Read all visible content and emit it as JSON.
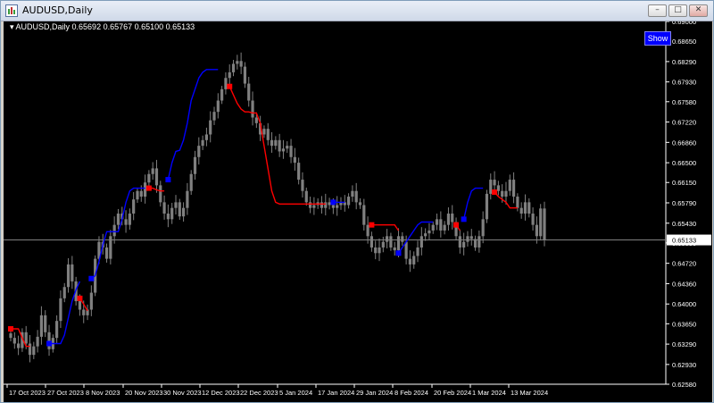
{
  "window": {
    "title": "AUDUSD,Daily",
    "buttons": [
      "minimize",
      "restore",
      "close"
    ],
    "icons": {
      "minimize": "–",
      "restore": "□",
      "close": "✕"
    }
  },
  "chart": {
    "info_line": "AUDUSD,Daily  0.65692 0.65767 0.65100 0.65133",
    "current_price": "0.65133",
    "show_button": "Show",
    "colors": {
      "background": "#000000",
      "candles": "#808080",
      "uptrend": "#0000ff",
      "downtrend": "#ff0000",
      "text": "#ffffff"
    }
  },
  "chart_data": {
    "type": "line",
    "symbol": "AUDUSD",
    "timeframe": "Daily",
    "x_labels": [
      "17 Oct 2023",
      "27 Oct 2023",
      "8 Nov 2023",
      "20 Nov 2023",
      "30 Nov 2023",
      "12 Dec 2023",
      "22 Dec 2023",
      "5 Jan 2024",
      "17 Jan 2024",
      "29 Jan 2024",
      "8 Feb 2024",
      "20 Feb 2024",
      "1 Mar 2024",
      "13 Mar 2024"
    ],
    "y_ticks": [
      "0.69000",
      "0.68650",
      "0.68290",
      "0.67930",
      "0.67580",
      "0.67220",
      "0.66860",
      "0.66500",
      "0.66150",
      "0.65790",
      "0.65430",
      "0.65080",
      "0.64720",
      "0.64360",
      "0.64000",
      "0.63650",
      "0.63290",
      "0.62930",
      "0.62580"
    ],
    "ylim": [
      0.6258,
      0.69
    ],
    "current_price": 0.65133,
    "close_prices": [
      0.634,
      0.633,
      0.6322,
      0.635,
      0.633,
      0.631,
      0.6325,
      0.6342,
      0.638,
      0.635,
      0.632,
      0.634,
      0.637,
      0.641,
      0.643,
      0.647,
      0.644,
      0.6405,
      0.639,
      0.638,
      0.639,
      0.642,
      0.648,
      0.651,
      0.65,
      0.648,
      0.652,
      0.654,
      0.656,
      0.655,
      0.654,
      0.656,
      0.6585,
      0.66,
      0.659,
      0.6615,
      0.663,
      0.664,
      0.661,
      0.658,
      0.656,
      0.655,
      0.657,
      0.658,
      0.6555,
      0.657,
      0.66,
      0.663,
      0.666,
      0.668,
      0.669,
      0.67,
      0.6725,
      0.674,
      0.676,
      0.678,
      0.68,
      0.681,
      0.6825,
      0.683,
      0.682,
      0.679,
      0.676,
      0.673,
      0.672,
      0.67,
      0.671,
      0.669,
      0.668,
      0.669,
      0.667,
      0.6675,
      0.668,
      0.666,
      0.665,
      0.662,
      0.66,
      0.658,
      0.657,
      0.6575,
      0.658,
      0.657,
      0.658,
      0.6575,
      0.657,
      0.6575,
      0.658,
      0.6575,
      0.659,
      0.66,
      0.658,
      0.6575,
      0.654,
      0.652,
      0.65,
      0.649,
      0.65,
      0.651,
      0.652,
      0.65,
      0.6495,
      0.652,
      0.651,
      0.648,
      0.647,
      0.6485,
      0.65,
      0.652,
      0.6525,
      0.653,
      0.654,
      0.655,
      0.653,
      0.654,
      0.656,
      0.6545,
      0.652,
      0.65,
      0.651,
      0.652,
      0.6515,
      0.65,
      0.652,
      0.655,
      0.6595,
      0.662,
      0.661,
      0.66,
      0.659,
      0.66,
      0.662,
      0.659,
      0.657,
      0.656,
      0.658,
      0.656,
      0.654,
      0.652,
      0.6569,
      0.6513
    ],
    "series": [
      {
        "name": "",
        "color": "#0000ff",
        "segments": [
          {
            "start": 10,
            "values": [
              0.633,
              0.633,
              0.633,
              0.633,
              0.6345,
              0.6375,
              0.6405,
              0.6425,
              0.644
            ]
          },
          {
            "start": 21,
            "values": [
              0.6445,
              0.645,
              0.6475,
              0.6505,
              0.6528,
              0.6528,
              0.6528,
              0.6528,
              0.655,
              0.658,
              0.66,
              0.6605,
              0.6605,
              0.6605,
              0.6605
            ]
          },
          {
            "start": 41,
            "values": [
              0.662,
              0.665,
              0.667,
              0.6672,
              0.669,
              0.672,
              0.676,
              0.678,
              0.68,
              0.681,
              0.6815,
              0.6815,
              0.6815,
              0.6815
            ]
          },
          {
            "start": 84,
            "values": [
              0.658,
              0.658,
              0.658,
              0.658
            ]
          },
          {
            "start": 101,
            "values": [
              0.649,
              0.65,
              0.651,
              0.652,
              0.653,
              0.654,
              0.6545,
              0.6545,
              0.6545,
              0.6545
            ]
          },
          {
            "start": 118,
            "values": [
              0.655,
              0.658,
              0.66,
              0.6605,
              0.6605,
              0.6605
            ]
          }
        ]
      },
      {
        "name": "",
        "color": "#ff0000",
        "segments": [
          {
            "start": 0,
            "values": [
              0.6356,
              0.6356,
              0.6356,
              0.634,
              0.6325,
              0.6325
            ]
          },
          {
            "start": 18,
            "values": [
              0.641,
              0.64,
              0.6388
            ]
          },
          {
            "start": 36,
            "values": [
              0.6605,
              0.6605,
              0.6602,
              0.66,
              0.66
            ]
          },
          {
            "start": 57,
            "values": [
              0.6785,
              0.677,
              0.6755,
              0.6745,
              0.674,
              0.674,
              0.6738,
              0.6738,
              0.672,
              0.668,
              0.664,
              0.66,
              0.658,
              0.6577,
              0.6577,
              0.6577,
              0.6577,
              0.6577,
              0.6577,
              0.6577,
              0.6577,
              0.6577,
              0.6577,
              0.6577,
              0.6577,
              0.6577
            ]
          },
          {
            "start": 94,
            "values": [
              0.654,
              0.654,
              0.654,
              0.654,
              0.654,
              0.654,
              0.654,
              0.653
            ]
          },
          {
            "start": 116,
            "values": [
              0.654,
              0.653
            ]
          },
          {
            "start": 126,
            "values": [
              0.6598,
              0.659,
              0.6585,
              0.658,
              0.657,
              0.657,
              0.657
            ]
          }
        ]
      }
    ],
    "grid": false,
    "legend": "none"
  }
}
